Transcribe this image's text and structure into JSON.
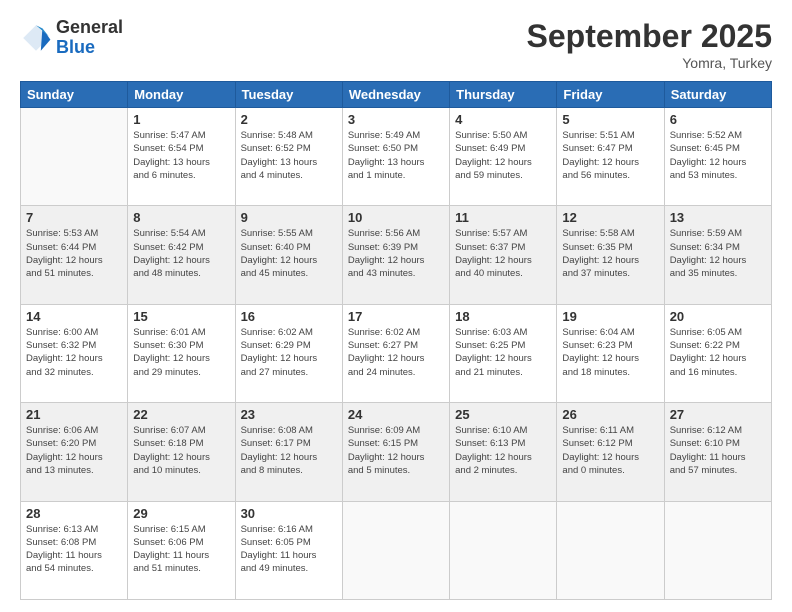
{
  "header": {
    "logo_line1": "General",
    "logo_line2": "Blue",
    "month": "September 2025",
    "location": "Yomra, Turkey"
  },
  "days_of_week": [
    "Sunday",
    "Monday",
    "Tuesday",
    "Wednesday",
    "Thursday",
    "Friday",
    "Saturday"
  ],
  "weeks": [
    [
      {
        "day": "",
        "info": ""
      },
      {
        "day": "1",
        "info": "Sunrise: 5:47 AM\nSunset: 6:54 PM\nDaylight: 13 hours\nand 6 minutes."
      },
      {
        "day": "2",
        "info": "Sunrise: 5:48 AM\nSunset: 6:52 PM\nDaylight: 13 hours\nand 4 minutes."
      },
      {
        "day": "3",
        "info": "Sunrise: 5:49 AM\nSunset: 6:50 PM\nDaylight: 13 hours\nand 1 minute."
      },
      {
        "day": "4",
        "info": "Sunrise: 5:50 AM\nSunset: 6:49 PM\nDaylight: 12 hours\nand 59 minutes."
      },
      {
        "day": "5",
        "info": "Sunrise: 5:51 AM\nSunset: 6:47 PM\nDaylight: 12 hours\nand 56 minutes."
      },
      {
        "day": "6",
        "info": "Sunrise: 5:52 AM\nSunset: 6:45 PM\nDaylight: 12 hours\nand 53 minutes."
      }
    ],
    [
      {
        "day": "7",
        "info": "Sunrise: 5:53 AM\nSunset: 6:44 PM\nDaylight: 12 hours\nand 51 minutes."
      },
      {
        "day": "8",
        "info": "Sunrise: 5:54 AM\nSunset: 6:42 PM\nDaylight: 12 hours\nand 48 minutes."
      },
      {
        "day": "9",
        "info": "Sunrise: 5:55 AM\nSunset: 6:40 PM\nDaylight: 12 hours\nand 45 minutes."
      },
      {
        "day": "10",
        "info": "Sunrise: 5:56 AM\nSunset: 6:39 PM\nDaylight: 12 hours\nand 43 minutes."
      },
      {
        "day": "11",
        "info": "Sunrise: 5:57 AM\nSunset: 6:37 PM\nDaylight: 12 hours\nand 40 minutes."
      },
      {
        "day": "12",
        "info": "Sunrise: 5:58 AM\nSunset: 6:35 PM\nDaylight: 12 hours\nand 37 minutes."
      },
      {
        "day": "13",
        "info": "Sunrise: 5:59 AM\nSunset: 6:34 PM\nDaylight: 12 hours\nand 35 minutes."
      }
    ],
    [
      {
        "day": "14",
        "info": "Sunrise: 6:00 AM\nSunset: 6:32 PM\nDaylight: 12 hours\nand 32 minutes."
      },
      {
        "day": "15",
        "info": "Sunrise: 6:01 AM\nSunset: 6:30 PM\nDaylight: 12 hours\nand 29 minutes."
      },
      {
        "day": "16",
        "info": "Sunrise: 6:02 AM\nSunset: 6:29 PM\nDaylight: 12 hours\nand 27 minutes."
      },
      {
        "day": "17",
        "info": "Sunrise: 6:02 AM\nSunset: 6:27 PM\nDaylight: 12 hours\nand 24 minutes."
      },
      {
        "day": "18",
        "info": "Sunrise: 6:03 AM\nSunset: 6:25 PM\nDaylight: 12 hours\nand 21 minutes."
      },
      {
        "day": "19",
        "info": "Sunrise: 6:04 AM\nSunset: 6:23 PM\nDaylight: 12 hours\nand 18 minutes."
      },
      {
        "day": "20",
        "info": "Sunrise: 6:05 AM\nSunset: 6:22 PM\nDaylight: 12 hours\nand 16 minutes."
      }
    ],
    [
      {
        "day": "21",
        "info": "Sunrise: 6:06 AM\nSunset: 6:20 PM\nDaylight: 12 hours\nand 13 minutes."
      },
      {
        "day": "22",
        "info": "Sunrise: 6:07 AM\nSunset: 6:18 PM\nDaylight: 12 hours\nand 10 minutes."
      },
      {
        "day": "23",
        "info": "Sunrise: 6:08 AM\nSunset: 6:17 PM\nDaylight: 12 hours\nand 8 minutes."
      },
      {
        "day": "24",
        "info": "Sunrise: 6:09 AM\nSunset: 6:15 PM\nDaylight: 12 hours\nand 5 minutes."
      },
      {
        "day": "25",
        "info": "Sunrise: 6:10 AM\nSunset: 6:13 PM\nDaylight: 12 hours\nand 2 minutes."
      },
      {
        "day": "26",
        "info": "Sunrise: 6:11 AM\nSunset: 6:12 PM\nDaylight: 12 hours\nand 0 minutes."
      },
      {
        "day": "27",
        "info": "Sunrise: 6:12 AM\nSunset: 6:10 PM\nDaylight: 11 hours\nand 57 minutes."
      }
    ],
    [
      {
        "day": "28",
        "info": "Sunrise: 6:13 AM\nSunset: 6:08 PM\nDaylight: 11 hours\nand 54 minutes."
      },
      {
        "day": "29",
        "info": "Sunrise: 6:15 AM\nSunset: 6:06 PM\nDaylight: 11 hours\nand 51 minutes."
      },
      {
        "day": "30",
        "info": "Sunrise: 6:16 AM\nSunset: 6:05 PM\nDaylight: 11 hours\nand 49 minutes."
      },
      {
        "day": "",
        "info": ""
      },
      {
        "day": "",
        "info": ""
      },
      {
        "day": "",
        "info": ""
      },
      {
        "day": "",
        "info": ""
      }
    ]
  ]
}
